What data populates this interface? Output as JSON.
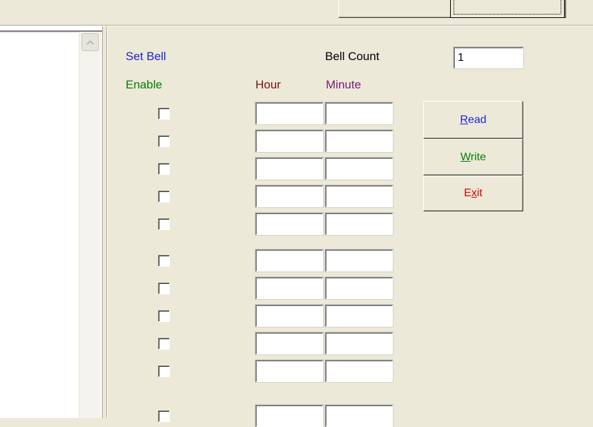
{
  "labels": {
    "set_bell": "Set Bell",
    "bell_count": "Bell Count",
    "enable": "Enable",
    "hour": "Hour",
    "minute": "Minute"
  },
  "bell_count_value": "1",
  "buttons": {
    "read": {
      "pre": "",
      "key": "R",
      "post": "ead"
    },
    "write": {
      "pre": "",
      "key": "W",
      "post": "rite"
    },
    "exit": {
      "pre": "E",
      "key": "x",
      "post": "it"
    }
  },
  "rows": [
    {
      "enabled": false,
      "hour": "",
      "minute": ""
    },
    {
      "enabled": false,
      "hour": "",
      "minute": ""
    },
    {
      "enabled": false,
      "hour": "",
      "minute": ""
    },
    {
      "enabled": false,
      "hour": "",
      "minute": ""
    },
    {
      "enabled": false,
      "hour": "",
      "minute": ""
    },
    {
      "enabled": false,
      "hour": "",
      "minute": ""
    },
    {
      "enabled": false,
      "hour": "",
      "minute": ""
    },
    {
      "enabled": false,
      "hour": "",
      "minute": ""
    },
    {
      "enabled": false,
      "hour": "",
      "minute": ""
    },
    {
      "enabled": false,
      "hour": "",
      "minute": ""
    },
    {
      "enabled": false,
      "hour": "",
      "minute": ""
    }
  ],
  "colors": {
    "set_bell": "#1f1fd6",
    "enable": "#008000",
    "hour": "#7a1010",
    "minute": "#7a1a7a",
    "read": "#1f1fd6",
    "write": "#008000",
    "exit": "#e00000"
  },
  "icons": {
    "scroll_up": "chevron-up-icon"
  }
}
